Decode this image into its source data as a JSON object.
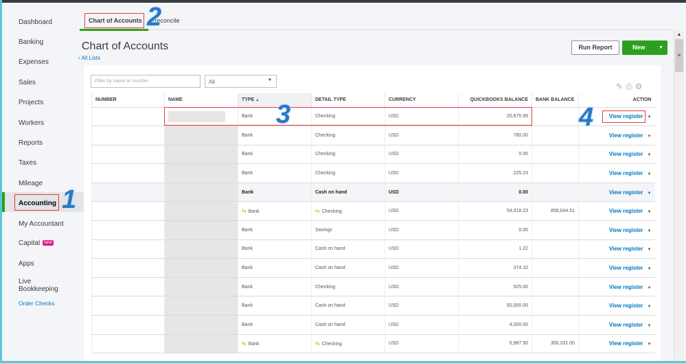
{
  "sidebar": {
    "items": [
      {
        "label": "Dashboard"
      },
      {
        "label": "Banking"
      },
      {
        "label": "Expenses"
      },
      {
        "label": "Sales"
      },
      {
        "label": "Projects"
      },
      {
        "label": "Workers"
      },
      {
        "label": "Reports"
      },
      {
        "label": "Taxes"
      },
      {
        "label": "Mileage"
      },
      {
        "label": "Accounting",
        "active": true
      },
      {
        "label": "My Accountant"
      },
      {
        "label": "Capital",
        "badge": "NEW"
      },
      {
        "label": "Apps"
      },
      {
        "label": "Live Bookkeeping"
      }
    ],
    "order_checks": "Order Checks"
  },
  "tabs": [
    {
      "label": "Chart of Accounts",
      "active": true
    },
    {
      "label": "Reconcile"
    }
  ],
  "page": {
    "title": "Chart of Accounts",
    "back_link": "All Lists",
    "run_report": "Run Report",
    "new": "New"
  },
  "filters": {
    "search_placeholder": "Filter by name or number",
    "type_select": "All"
  },
  "table": {
    "headers": [
      "NUMBER",
      "NAME",
      "TYPE",
      "DETAIL TYPE",
      "CURRENCY",
      "QUICKBOOKS BALANCE",
      "BANK BALANCE",
      "ACTION"
    ],
    "rows": [
      {
        "type": "Bank",
        "detail": "Checking",
        "currency": "USD",
        "qb": "20,675.99",
        "bank": "",
        "action": "View register"
      },
      {
        "type": "Bank",
        "detail": "Checking",
        "currency": "USD",
        "qb": "780.00",
        "bank": "",
        "action": "View register"
      },
      {
        "type": "Bank",
        "detail": "Checking",
        "currency": "USD",
        "qb": "0.00",
        "bank": "",
        "action": "View register"
      },
      {
        "type": "Bank",
        "detail": "Checking",
        "currency": "USD",
        "qb": "225.23",
        "bank": "",
        "action": "View register"
      },
      {
        "type": "Bank",
        "detail": "Cash on hand",
        "currency": "USD",
        "qb": "0.00",
        "bank": "",
        "action": "View register"
      },
      {
        "type": "Bank",
        "detail": "Checking",
        "currency": "USD",
        "qb": "54,018.23",
        "bank": "856,044.51",
        "action": "View register",
        "linked": true
      },
      {
        "type": "Bank",
        "detail": "Savings",
        "currency": "USD",
        "qb": "0.00",
        "bank": "",
        "action": "View register"
      },
      {
        "type": "Bank",
        "detail": "Cash on hand",
        "currency": "USD",
        "qb": "1.22",
        "bank": "",
        "action": "View register"
      },
      {
        "type": "Bank",
        "detail": "Cash on hand",
        "currency": "USD",
        "qb": "374.10",
        "bank": "",
        "action": "View register"
      },
      {
        "type": "Bank",
        "detail": "Checking",
        "currency": "USD",
        "qb": "925.00",
        "bank": "",
        "action": "View register"
      },
      {
        "type": "Bank",
        "detail": "Cash on hand",
        "currency": "USD",
        "qb": "50,000.00",
        "bank": "",
        "action": "View register"
      },
      {
        "type": "Bank",
        "detail": "Cash on hand",
        "currency": "USD",
        "qb": "4,000.00",
        "bank": "",
        "action": "View register"
      },
      {
        "type": "Bank",
        "detail": "Checking",
        "currency": "USD",
        "qb": "5,987.50",
        "bank": "300,331.00",
        "action": "View register",
        "linked": true
      }
    ]
  },
  "annotations": [
    "1",
    "2",
    "3",
    "4"
  ],
  "colors": {
    "accent_green": "#2ca01c",
    "link_blue": "#0077c5",
    "annotation_red": "#e8383d",
    "annotation_blue": "#2d78c4"
  }
}
